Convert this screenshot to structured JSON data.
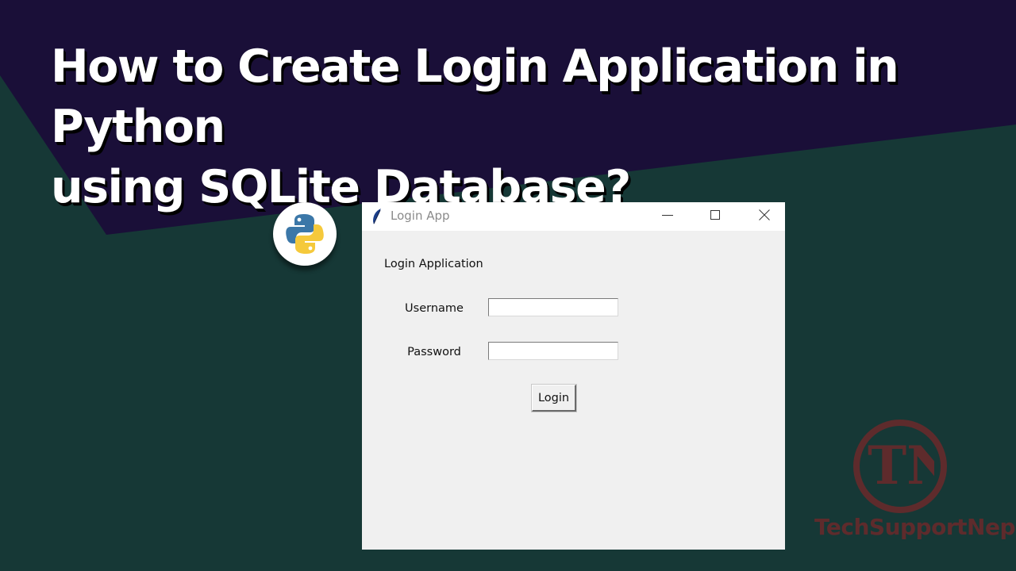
{
  "headline": {
    "line1": "How to Create Login Application in Python",
    "line2": "using SQLite Database?"
  },
  "colors": {
    "background_primary": "#163836",
    "background_band": "#1a0f38",
    "watermark": "#5e2b2c"
  },
  "logo": {
    "icon": "python-logo-icon"
  },
  "window": {
    "title": "Login App",
    "title_icon": "tk-feather-icon",
    "controls": [
      "minimize-icon",
      "maximize-icon",
      "close-icon"
    ],
    "app_label": "Login Application",
    "username_label": "Username",
    "username_value": "",
    "password_label": "Password",
    "password_value": "",
    "login_button": "Login"
  },
  "watermark": {
    "monogram": "TN",
    "text": "TechSupportNep"
  }
}
